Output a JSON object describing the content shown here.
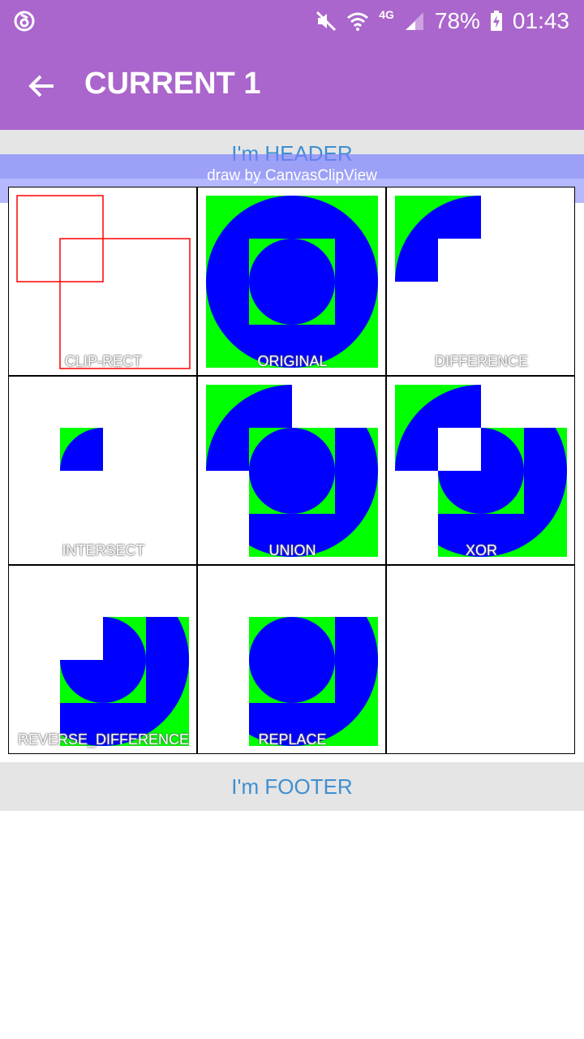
{
  "status_bar": {
    "battery": "78%",
    "time": "01:43",
    "network": "4G",
    "icons": [
      "app-notification-icon",
      "mute-icon",
      "wifi-icon",
      "signal-icon",
      "battery-charging-icon"
    ]
  },
  "toolbar": {
    "title": "CURRENT 1",
    "back_icon": "arrow-back-icon",
    "color": "#aa66cc"
  },
  "header": {
    "text": "I'm HEADER",
    "draw_by": "draw by CanvasClipView"
  },
  "cells": [
    {
      "label": "CLIP-RECT"
    },
    {
      "label": "ORIGINAL"
    },
    {
      "label": "DIFFERENCE"
    },
    {
      "label": "INTERSECT"
    },
    {
      "label": "UNION"
    },
    {
      "label": "XOR"
    },
    {
      "label": "REVERSE_DIFFERENCE"
    },
    {
      "label": "REPLACE"
    },
    {
      "label": ""
    }
  ],
  "footer": {
    "text": "I'm FOOTER"
  },
  "colors": {
    "shape_fill": "#0000ff",
    "square_fill": "#00ff00",
    "clip_stroke": "#ff0000"
  }
}
